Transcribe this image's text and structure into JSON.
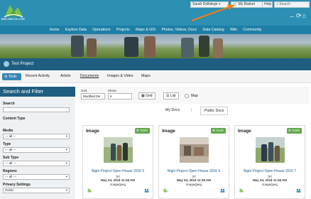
{
  "header": {
    "logo_text": "BAY-DELTA LIVE",
    "user_name": "Sarah Dollidege",
    "user_menu_icon": "chevron-down-icon",
    "basket_label": "My Basket",
    "help_label": "Help",
    "search_placeholder": "Search",
    "nav_icons": [
      "arrow-left-icon",
      "refresh-icon",
      "home-icon"
    ],
    "colors": {
      "bar": "#2c8fb3",
      "nav": "#1d7fa6",
      "project_bar": "#1f5e80",
      "annotation_arrow": "#f07d1a"
    }
  },
  "nav": {
    "items": [
      "Home",
      "Explore Data",
      "Operations",
      "Projects",
      "Maps & GIS",
      "Photos, Videos, Docs",
      "Data Catalog",
      "Wiki",
      "Community"
    ]
  },
  "project": {
    "title": "Test Project"
  },
  "tabs": {
    "tools_label": "Tools",
    "items": [
      "Recent Activity",
      "Article",
      "Documents",
      "Images & Video",
      "Maps"
    ],
    "active": "Documents"
  },
  "sidebar": {
    "title": "Search and Filter",
    "search_label": "Search",
    "search_value": "",
    "filters": [
      {
        "label": "Content Type",
        "value": ""
      },
      {
        "label": "Media",
        "value": "--- all ---"
      },
      {
        "label": "Type",
        "value": "--- all ---"
      },
      {
        "label": "Sub Type",
        "value": "--- all ---"
      },
      {
        "label": "Regions",
        "value": "--- all ---"
      },
      {
        "label": "Privacy Settings",
        "value": "Public"
      }
    ]
  },
  "sort": {
    "sort_label": "Sort:",
    "sort_value": "Modified D",
    "show_label": "Show:",
    "show_value": "6",
    "grid_label": "Grid",
    "list_label": "List",
    "map_label": "Map"
  },
  "doc_tabs": {
    "my_docs": "My Docs",
    "separator": "|",
    "public_docs": "Public Docs",
    "active": "Public Docs"
  },
  "cards": [
    {
      "type": "Image",
      "tools": "Tools",
      "title": "Nigiri Project Open House 2016 5",
      "flag": "[P]",
      "date": "May 04, 2016 11:28 AM",
      "mime": "image/jpeg"
    },
    {
      "type": "Image",
      "tools": "Tools",
      "title": "Nigiri Project Open House 2016 6",
      "flag": "[P]",
      "date": "May 04, 2016 11:28 AM",
      "mime": "image/jpeg"
    },
    {
      "type": "Image",
      "tools": "Tools",
      "title": "Nigiri Project Open House 2016 7",
      "flag": "[P]",
      "date": "May 04, 2016 11:28 AM",
      "mime": "image/jpeg"
    }
  ]
}
